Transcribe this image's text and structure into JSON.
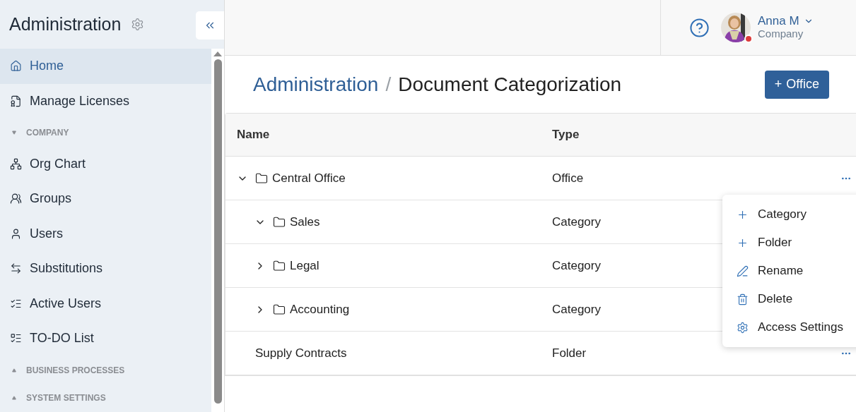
{
  "sidebar": {
    "title": "Administration",
    "items": [
      {
        "kind": "item",
        "label": "Home",
        "selected": true
      },
      {
        "kind": "item",
        "label": "Manage Licenses",
        "selected": false
      },
      {
        "kind": "section",
        "label": "COMPANY",
        "expanded": true
      },
      {
        "kind": "item",
        "label": "Org Chart",
        "selected": false
      },
      {
        "kind": "item",
        "label": "Groups",
        "selected": false
      },
      {
        "kind": "item",
        "label": "Users",
        "selected": false
      },
      {
        "kind": "item",
        "label": "Substitutions",
        "selected": false
      },
      {
        "kind": "item",
        "label": "Active Users",
        "selected": false
      },
      {
        "kind": "item",
        "label": "TO-DO List",
        "selected": false
      },
      {
        "kind": "section",
        "label": "BUSINESS PROCESSES",
        "expanded": false
      },
      {
        "kind": "section",
        "label": "SYSTEM SETTINGS",
        "expanded": false
      }
    ]
  },
  "user": {
    "name": "Anna M",
    "company": "Company",
    "online": false
  },
  "breadcrumb": {
    "parent": "Administration",
    "separator": "/",
    "current": "Document Categorization"
  },
  "add_button": {
    "icon": "+",
    "label": "Office"
  },
  "table": {
    "columns": [
      "Name",
      "Type"
    ],
    "rows": [
      {
        "name": "Central Office",
        "type": "Office",
        "kind": "office",
        "expanded": true,
        "menu": true,
        "children": [
          {
            "name": "Sales",
            "type": "Category",
            "kind": "category",
            "expanded": true
          },
          {
            "name": "Legal",
            "type": "Category",
            "kind": "category",
            "expanded": false
          },
          {
            "name": "Accounting",
            "type": "Category",
            "kind": "category",
            "expanded": false
          }
        ]
      },
      {
        "name": "Supply Contracts",
        "type": "Folder",
        "kind": "folder",
        "menu": true
      }
    ]
  },
  "context_menu": [
    {
      "label": "Category"
    },
    {
      "label": "Folder"
    },
    {
      "label": "Rename"
    },
    {
      "label": "Delete"
    },
    {
      "label": "Access Settings"
    }
  ]
}
